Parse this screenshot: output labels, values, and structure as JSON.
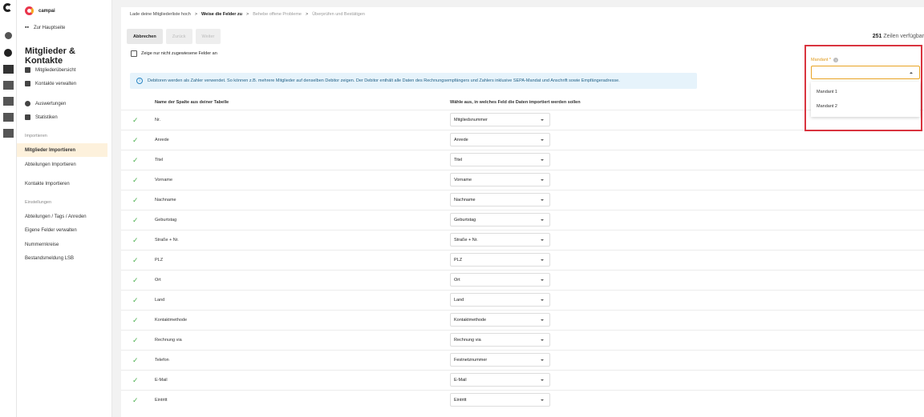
{
  "sidebar": {
    "brand": "campai",
    "home_link": "Zur Hauptseite",
    "section_title": "Mitglieder & Kontakte",
    "items_top": [
      {
        "label": "Mitgliederübersicht",
        "icon": "member-list-icon"
      },
      {
        "label": "Kontakte verwalten",
        "icon": "contacts-icon"
      }
    ],
    "items_stats": [
      {
        "label": "Auswertungen",
        "icon": "pie-chart-icon"
      },
      {
        "label": "Statistiken",
        "icon": "line-chart-icon"
      }
    ],
    "import_section": "Importieren",
    "import_items": [
      "Mitglieder Importieren",
      "Abteilungen Importieren",
      "Kontakte Importieren"
    ],
    "settings_section": "Einstellungen",
    "settings_items": [
      "Abteilungen / Tags / Anreden",
      "Eigene Felder verwalten",
      "Nummernkreise",
      "Bestandsmeldung LSB"
    ]
  },
  "breadcrumbs": {
    "step1": "Lade deine Mitgliederliste hoch",
    "step2": "Weise die Felder zu",
    "step3": "Behebe offene Probleme",
    "step4": "Überprüfen und Bestätigen",
    "separator": ">"
  },
  "toolbar": {
    "cancel": "Abbrechen",
    "back": "Zurück",
    "next": "Weiter"
  },
  "rows_available": {
    "count": "251",
    "label": "Zeilen verfügbar"
  },
  "checkbox_label": "Zeige nur nicht zugewiesene Felder an",
  "info_text": "Debitoren werden als Zahler verwendet. So können z.B. mehrere Mitglieder auf denselben Debitor zeigen. Der Debitor enthält alle Daten des Rechnungsempfängers und Zahlers inklusive SEPA-Mandat und Anschrift sowie Empfängeradresse.",
  "table": {
    "col_source": "Name der Spalte aus deiner Tabelle",
    "col_target": "Wähle aus, in welches Feld die Daten importiert werden sollen",
    "rows": [
      {
        "name": "Nr.",
        "field": "Mitgliedsnummer"
      },
      {
        "name": "Anrede",
        "field": "Anrede"
      },
      {
        "name": "Titel",
        "field": "Titel"
      },
      {
        "name": "Vorname",
        "field": "Vorname"
      },
      {
        "name": "Nachname",
        "field": "Nachname"
      },
      {
        "name": "Geburtstag",
        "field": "Geburtstag"
      },
      {
        "name": "Straße + Nr.",
        "field": "Straße + Nr."
      },
      {
        "name": "PLZ",
        "field": "PLZ"
      },
      {
        "name": "Ort",
        "field": "Ort"
      },
      {
        "name": "Land",
        "field": "Land"
      },
      {
        "name": "Kontaktmethode",
        "field": "Kontaktmethode"
      },
      {
        "name": "Rechnung via",
        "field": "Rechnung via"
      },
      {
        "name": "Telefon",
        "field": "Festnetznummer"
      },
      {
        "name": "E-Mail",
        "field": "E-Mail"
      },
      {
        "name": "Eintritt",
        "field": "Eintritt"
      }
    ]
  },
  "mandant": {
    "label": "Mandant *",
    "value": "",
    "options": [
      "Mandant 1",
      "Mandant 2"
    ]
  },
  "colors": {
    "accent": "#f6a623",
    "highlight_border": "#d9343f",
    "check": "#4caf50",
    "info_bg": "#e6f3fb"
  }
}
